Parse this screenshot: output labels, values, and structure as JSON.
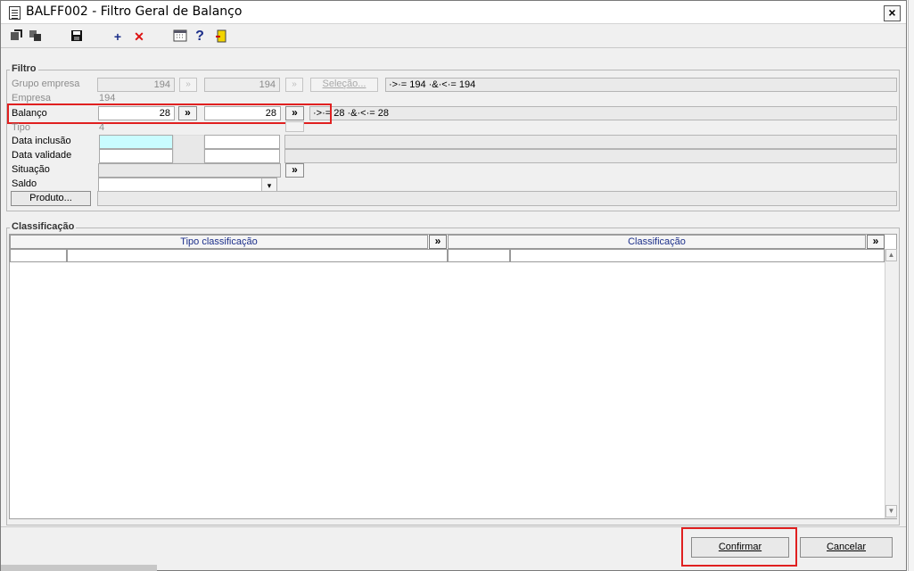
{
  "window": {
    "title": "BALFF002 - Filtro Geral de Balanço",
    "close_label": "×"
  },
  "toolbar": {
    "icons": [
      "arrow-icon",
      "copy-icon",
      "save-icon",
      "add-icon",
      "delete-icon",
      "calendar-icon",
      "help-icon",
      "exit-icon"
    ],
    "add_glyph": "+",
    "delete_glyph": "✕",
    "help_glyph": "?"
  },
  "filtro": {
    "legend": "Filtro",
    "grupo_empresa": {
      "label": "Grupo empresa",
      "from": "194",
      "to": "194",
      "selection_button": "Seleção...",
      "expression": "·>·= 194 ·&·<·= 194",
      "range_button": "»"
    },
    "empresa": {
      "label": "Empresa",
      "value": "194"
    },
    "balanco": {
      "label": "Balanço",
      "from": "28",
      "to": "28",
      "range_button": "»",
      "expression": "·>·= 28 ·&·<·= 28"
    },
    "tipo": {
      "label": "Tipo",
      "value": "4"
    },
    "data_inclusao": {
      "label": "Data inclusão",
      "from": "",
      "to": ""
    },
    "data_validade": {
      "label": "Data validade",
      "from": "",
      "to": ""
    },
    "situacao": {
      "label": "Situação",
      "value": "",
      "range_button": "»"
    },
    "saldo": {
      "label": "Saldo",
      "value": ""
    },
    "produto_button": "Produto...",
    "produto_value": ""
  },
  "classificacao": {
    "legend": "Classificação",
    "columns": [
      {
        "header": "Tipo classificação",
        "button": "»"
      },
      {
        "header": "Classificação",
        "button": "»"
      }
    ]
  },
  "footer": {
    "confirm_label": "Confirmar",
    "cancel_label": "Cancelar"
  },
  "colors": {
    "highlight_red": "#e02020",
    "cyan_field": "#c9fcff",
    "header_text": "#1c2f8a"
  }
}
